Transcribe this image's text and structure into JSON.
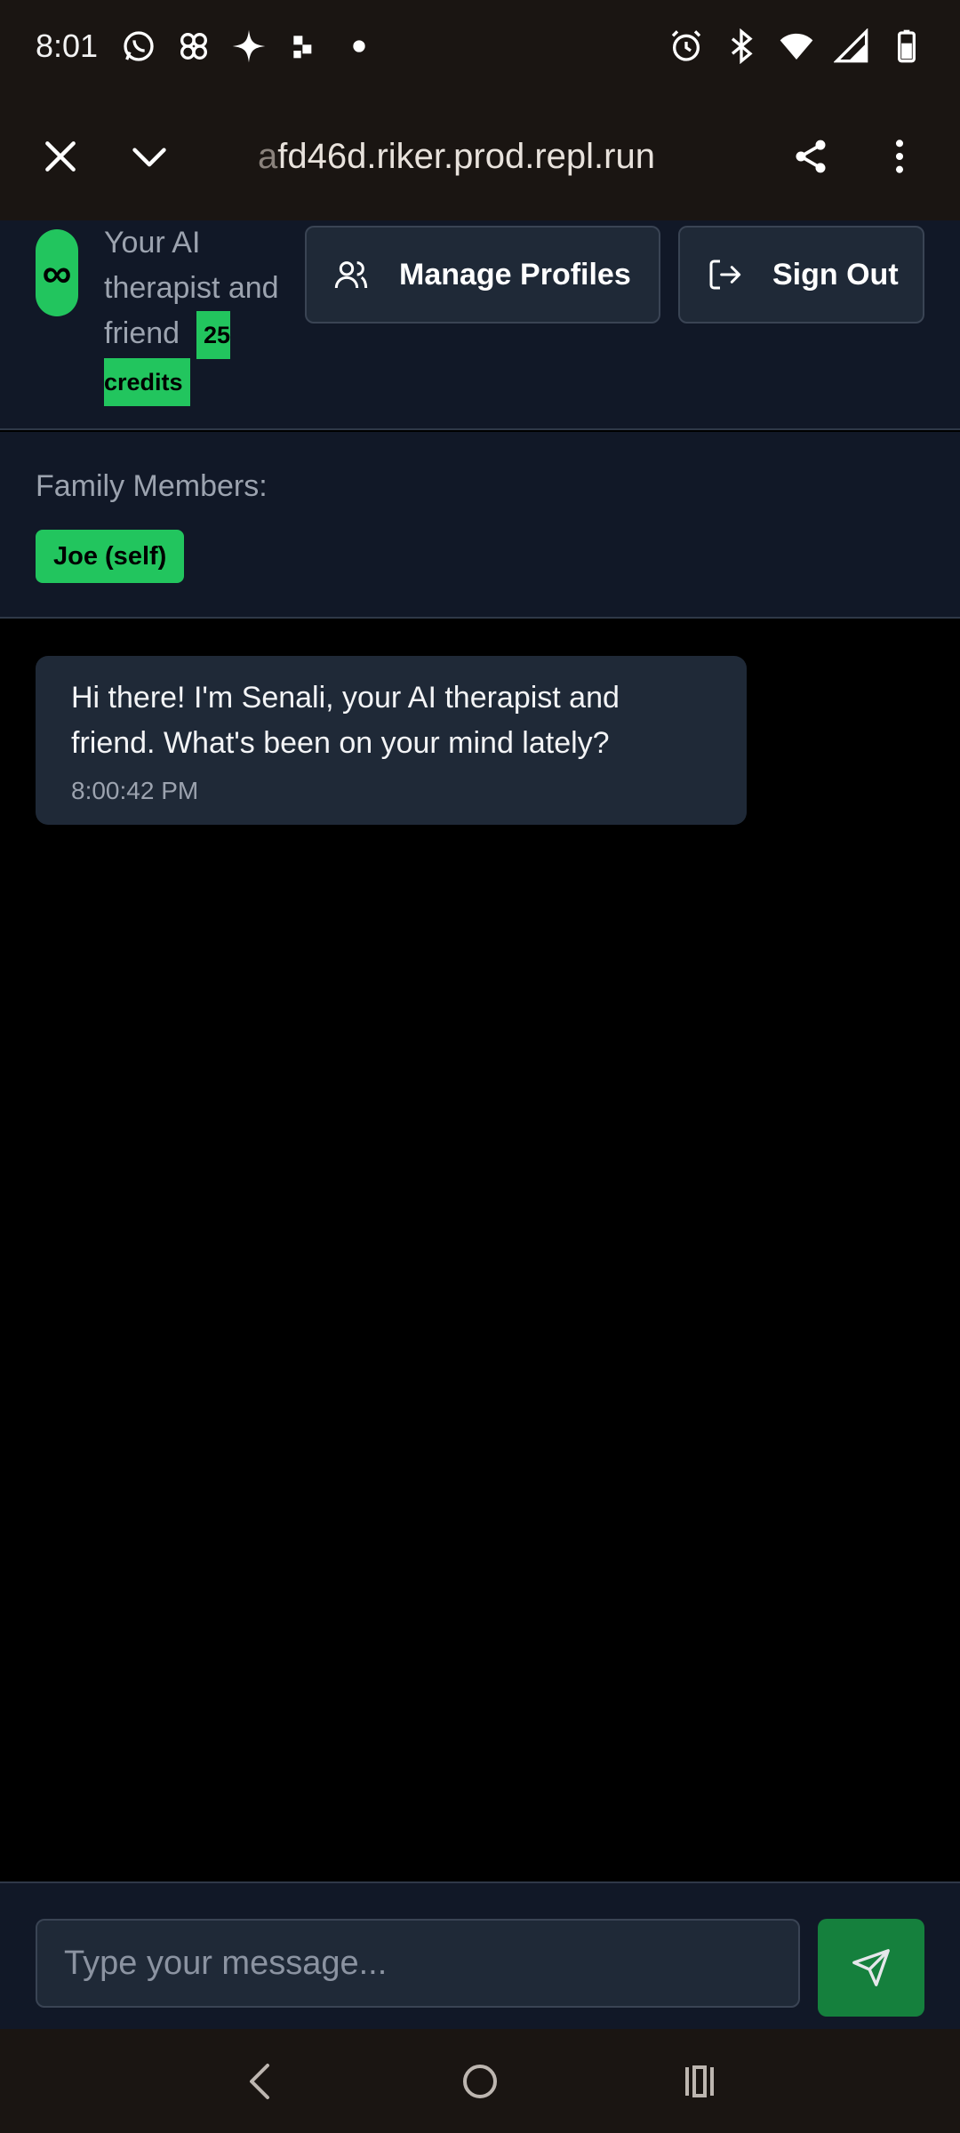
{
  "status_bar": {
    "time": "8:01",
    "left_icons": [
      "whatsapp-icon",
      "pinwheel-icon",
      "sparkle-icon",
      "app-notification-icon",
      "dot-icon"
    ],
    "right_icons": [
      "alarm-icon",
      "bluetooth-icon",
      "wifi-icon",
      "signal-icon",
      "battery-icon"
    ]
  },
  "browser": {
    "url_faded": "a",
    "url": "fd46d.riker.prod.repl.run"
  },
  "header": {
    "logo_symbol": "∞",
    "tagline": "Your AI therapist and friend",
    "credits": "25 credits",
    "manage_profiles_label": "Manage Profiles",
    "sign_out_label": "Sign Out"
  },
  "family": {
    "label": "Family Members:",
    "members": [
      {
        "name": "Joe (self)"
      }
    ]
  },
  "messages": [
    {
      "text": "Hi there! I'm Senali, your AI therapist and friend. What's been on your mind lately?",
      "time": "8:00:42 PM"
    }
  ],
  "composer": {
    "placeholder": "Type your message..."
  },
  "colors": {
    "accent": "#22c55e",
    "header_bg": "#111827",
    "bubble_bg": "#1f2937",
    "send_bg": "#15803d"
  }
}
